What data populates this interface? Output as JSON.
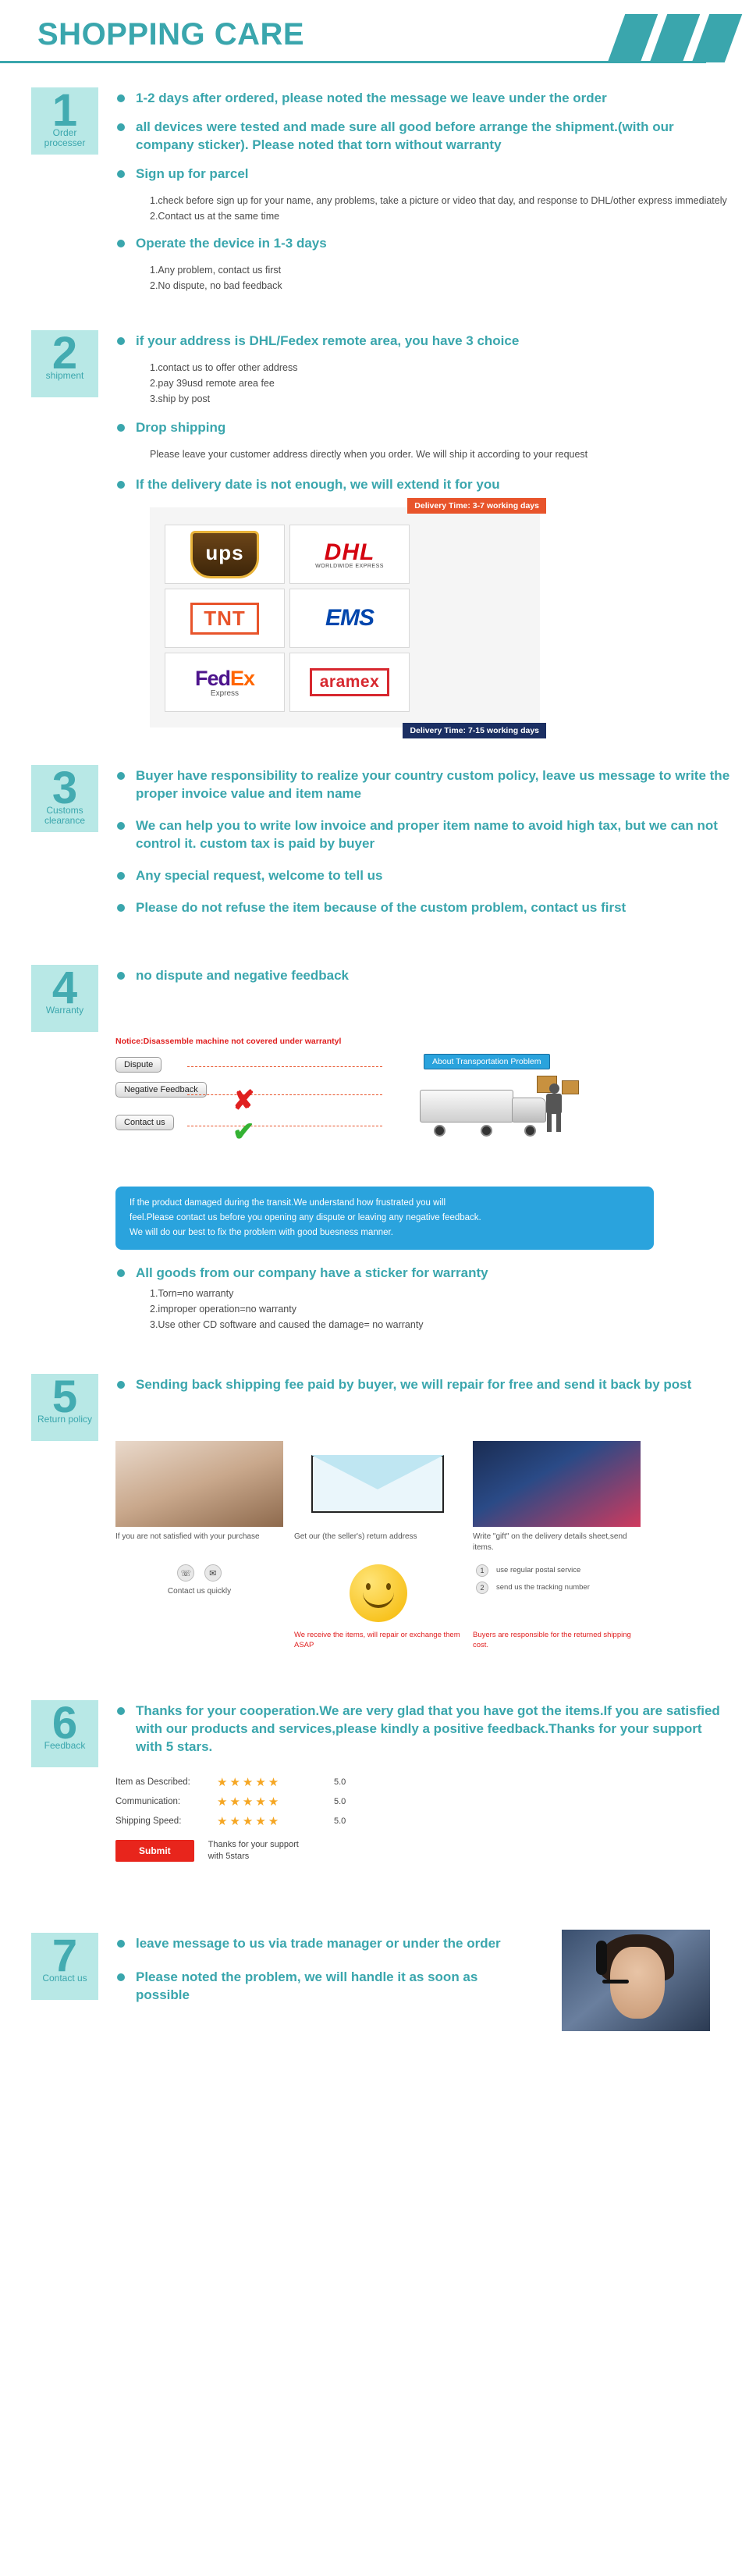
{
  "header": {
    "title": "SHOPPING CARE"
  },
  "sections": [
    {
      "num": "1",
      "label": "Order processer",
      "bullets": [
        {
          "text": "1-2 days after ordered, please noted the message we leave under the order",
          "subs": []
        },
        {
          "text": "all devices were tested and made sure all good before arrange the shipment.(with our company sticker). Please noted that torn without warranty",
          "subs": []
        },
        {
          "text": "Sign up for parcel",
          "subs": [
            "1.check before sign up for your name, any problems, take a picture or  video that day, and response to DHL/other express immediately",
            "2.Contact us at the same time"
          ]
        },
        {
          "text": "Operate the device in 1-3 days",
          "subs": [
            "1.Any problem, contact us first",
            "2.No dispute, no bad feedback"
          ]
        }
      ]
    },
    {
      "num": "2",
      "label": "shipment",
      "bullets": [
        {
          "text": "if your address is DHL/Fedex remote area, you have 3 choice",
          "subs": [
            "1.contact us to offer other address",
            "2.pay 39usd remote area fee",
            "3.ship by post"
          ]
        },
        {
          "text": "Drop shipping",
          "subs": [
            "Please leave your customer address directly when you order. We will ship it according to your request"
          ]
        },
        {
          "text": "If the delivery date is not enough, we will extend it for you",
          "subs": []
        }
      ]
    },
    {
      "num": "3",
      "label": "Customs clearance",
      "bullets": [
        {
          "text": "Buyer have responsibility to realize your country custom policy, leave us message to write the proper invoice value and item name",
          "subs": []
        },
        {
          "text": "We can help you to write low invoice and proper item name to avoid high tax, but we can not control it. custom tax is paid by buyer",
          "subs": []
        },
        {
          "text": "Any special request, welcome to tell us",
          "subs": []
        },
        {
          "text": "Please do not refuse the item because of the custom problem, contact us first",
          "subs": []
        }
      ]
    },
    {
      "num": "4",
      "label": "Warranty",
      "bullets": [
        {
          "text": "no dispute and negative feedback",
          "subs": []
        },
        {
          "text": "All goods from our company have a sticker for warranty",
          "subs": [
            "1.Torn=no warranty",
            "2.improper operation=no warranty",
            "3.Use other CD software and caused the damage= no warranty"
          ]
        }
      ]
    },
    {
      "num": "5",
      "label": "Return policy",
      "bullets": [
        {
          "text": "Sending back shipping fee paid by buyer, we will repair for free and send it back by post",
          "subs": []
        }
      ]
    },
    {
      "num": "6",
      "label": "Feedback",
      "bullets": [
        {
          "text": "Thanks for your cooperation.We are very glad that you have got the items.If you are satisfied with our products and services,please kindly a positive feedback.Thanks for your support with 5 stars.",
          "subs": []
        }
      ]
    },
    {
      "num": "7",
      "label": "Contact us",
      "bullets": [
        {
          "text": "leave message to us via trade manager or under the order",
          "subs": []
        },
        {
          "text": "Please noted the problem, we will handle it as soon as possible",
          "subs": []
        }
      ]
    }
  ],
  "courier": {
    "banner_top": "Delivery Time: 3-7 working days",
    "banner_bottom": "Delivery Time: 7-15 working days",
    "logos": [
      {
        "name": "UPS",
        "text": "ups"
      },
      {
        "name": "DHL",
        "text": "DHL",
        "sub": "WORLDWIDE EXPRESS"
      },
      {
        "name": "TNT",
        "text": "TNT"
      },
      {
        "name": "EMS",
        "text": "EMS"
      },
      {
        "name": "FedEx",
        "text_a": "Fed",
        "text_b": "Ex",
        "sub": "Express"
      },
      {
        "name": "Aramex",
        "text": "aramex"
      }
    ]
  },
  "warranty_flow": {
    "notice": "Notice:Disassemble machine not covered under warrantyl",
    "pill_dispute": "Dispute",
    "pill_negative": "Negative Feedback",
    "pill_contact": "Contact us",
    "mark_cross": "✘",
    "mark_check": "✔",
    "about_box": "About Transportation Problem",
    "blue_note_lines": [
      "If the product damaged during the transit.We understand how frustrated you will",
      "feel.Please contact us before you opening any dispute or leaving any negative feedback.",
      "We will do our best to fix the problem with good buesness manner."
    ]
  },
  "return_policy": {
    "captions": [
      "If you are not satisfied with your purchase",
      "Get our (the seller's) return address",
      "Write \"gift\" on the delivery details sheet,send items."
    ],
    "arrow": "»",
    "icons_caption": "Contact us quickly",
    "steps_right": [
      "use regular postal service",
      "send us the tracking number"
    ],
    "foot_left": "We receive the items, will repair or exchange them ASAP",
    "foot_right": "Buyers are responsible for the returned shipping cost.",
    "icon_phone": "☏",
    "icon_mail": "✉",
    "badge_1": "1",
    "badge_2": "2"
  },
  "feedback": {
    "rows": [
      {
        "label": "Item as Described:",
        "stars": "★★★★★",
        "score": "5.0"
      },
      {
        "label": "Communication:",
        "stars": "★★★★★",
        "score": "5.0"
      },
      {
        "label": "Shipping Speed:",
        "stars": "★★★★★",
        "score": "5.0"
      }
    ],
    "submit_label": "Submit",
    "submit_note_1": "Thanks for your support",
    "submit_note_2": "with 5stars"
  },
  "colors": {
    "teal": "#3aa6ad",
    "teal_light": "#b8e8e6",
    "red": "#e02020",
    "orange": "#e8542b",
    "navy": "#1b2f63",
    "blue": "#2aa3dd"
  }
}
